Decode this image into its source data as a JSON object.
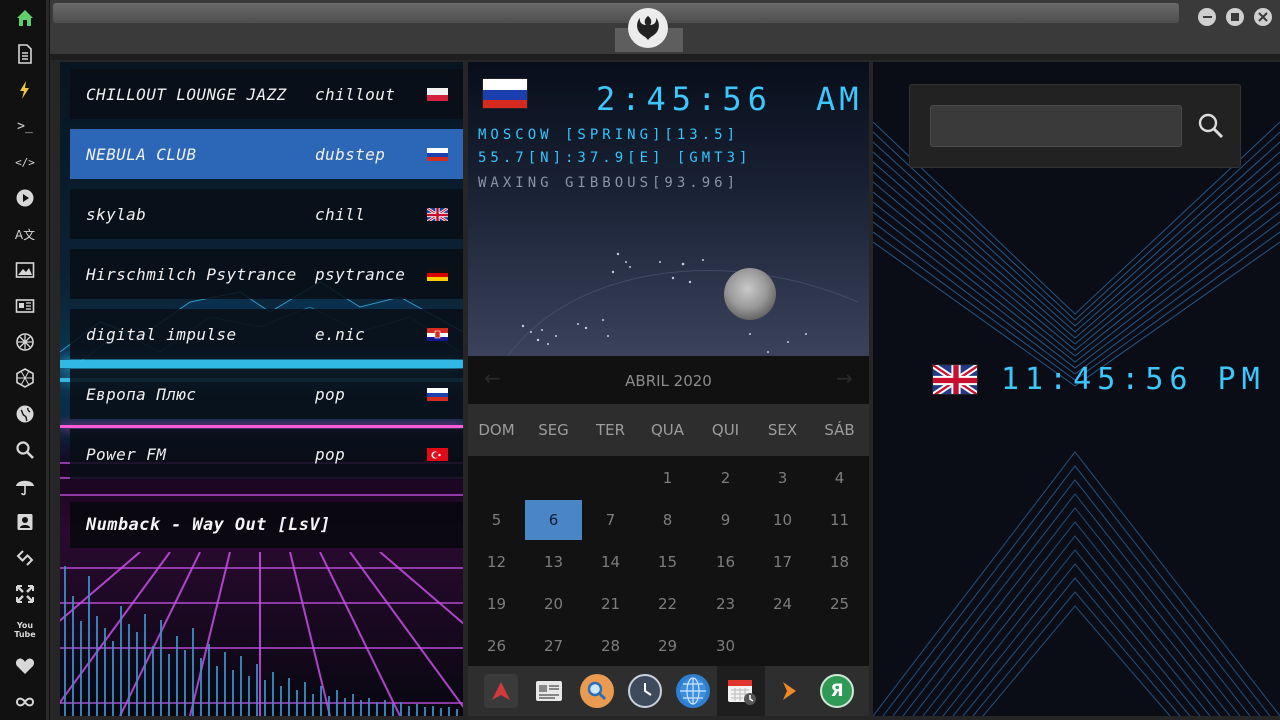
{
  "sidebar": {
    "items": [
      {
        "name": "home-icon",
        "glyph": "⌂"
      },
      {
        "name": "document-icon",
        "glyph": "▤"
      },
      {
        "name": "lightning-icon",
        "glyph": "⚡"
      },
      {
        "name": "terminal-icon",
        "glyph": ">_"
      },
      {
        "name": "code-icon",
        "glyph": "</>"
      },
      {
        "name": "play-icon",
        "glyph": "▶"
      },
      {
        "name": "translate-icon",
        "glyph": "A文"
      },
      {
        "name": "image-icon",
        "glyph": "▨"
      },
      {
        "name": "news-icon",
        "glyph": "▦"
      },
      {
        "name": "jedi-order-icon",
        "glyph": "✷"
      },
      {
        "name": "hexagon-icon",
        "glyph": "⬡"
      },
      {
        "name": "globe-icon",
        "glyph": "◍"
      },
      {
        "name": "search-icon",
        "glyph": "⌕"
      },
      {
        "name": "umbrella-icon",
        "glyph": "☂"
      },
      {
        "name": "contact-card-icon",
        "glyph": "▣"
      },
      {
        "name": "link-icon",
        "glyph": "⟐"
      },
      {
        "name": "expand-icon",
        "glyph": "✥"
      },
      {
        "name": "youtube-icon",
        "glyph": "You Tube"
      },
      {
        "name": "heart-icon",
        "glyph": "♥"
      },
      {
        "name": "infinity-icon",
        "glyph": "∞"
      }
    ]
  },
  "radio": {
    "stations": [
      {
        "name": "CHILLOUT LOUNGE JAZZ",
        "genre": "chillout",
        "flag": "poland"
      },
      {
        "name": "NEBULA CLUB",
        "genre": "dubstep",
        "flag": "russia"
      },
      {
        "name": "skylab",
        "genre": "chill",
        "flag": "uk"
      },
      {
        "name": "Hirschmilch Psytrance",
        "genre": "psytrance",
        "flag": "germany"
      },
      {
        "name": "digital impulse",
        "genre": "e.nic",
        "flag": "croatia"
      },
      {
        "name": "Европа Плюс",
        "genre": "pop",
        "flag": "russia"
      },
      {
        "name": "Power FM",
        "genre": "pop",
        "flag": "turkey"
      }
    ],
    "active_index": 1,
    "now_playing": "Numback - Way Out [LsV]"
  },
  "sky": {
    "time": "2:45:56",
    "ampm": "AM",
    "line1": "MOSCOW [SPRING][13.5]",
    "line2": "55.7[N]:37.9[E] [GMT3]",
    "line3": "WAXING GIBBOUS[93.96]",
    "line1_color": "#33c6ff",
    "line3_color": "#8a94a6"
  },
  "calendar": {
    "month_label": "ABRIL 2020",
    "prev_label": "←",
    "next_label": "→",
    "weekdays": [
      "DOM",
      "SEG",
      "TER",
      "QUA",
      "QUI",
      "SEX",
      "SÁB"
    ],
    "today": "6",
    "weeks": [
      [
        "",
        "",
        "",
        "1",
        "2",
        "3",
        "4"
      ],
      [
        "5",
        "6",
        "7",
        "8",
        "9",
        "10",
        "11"
      ],
      [
        "12",
        "13",
        "14",
        "15",
        "16",
        "17",
        "18"
      ],
      [
        "19",
        "20",
        "21",
        "22",
        "23",
        "24",
        "25"
      ],
      [
        "26",
        "27",
        "28",
        "29",
        "30",
        "",
        ""
      ]
    ]
  },
  "dock": {
    "items": [
      "arch-icon",
      "news-reader-icon",
      "search-app-icon",
      "clock-app-icon",
      "globe-app-icon",
      "calendar-app-icon",
      "arrow-app-icon",
      "yandex-icon"
    ],
    "selected_index": 5
  },
  "right": {
    "search_placeholder": "",
    "time": "11:45:56 PM"
  },
  "colors": {
    "accent_blue": "#2b66b7",
    "lcd": "#3cc7ff",
    "today": "#4a85c7"
  }
}
